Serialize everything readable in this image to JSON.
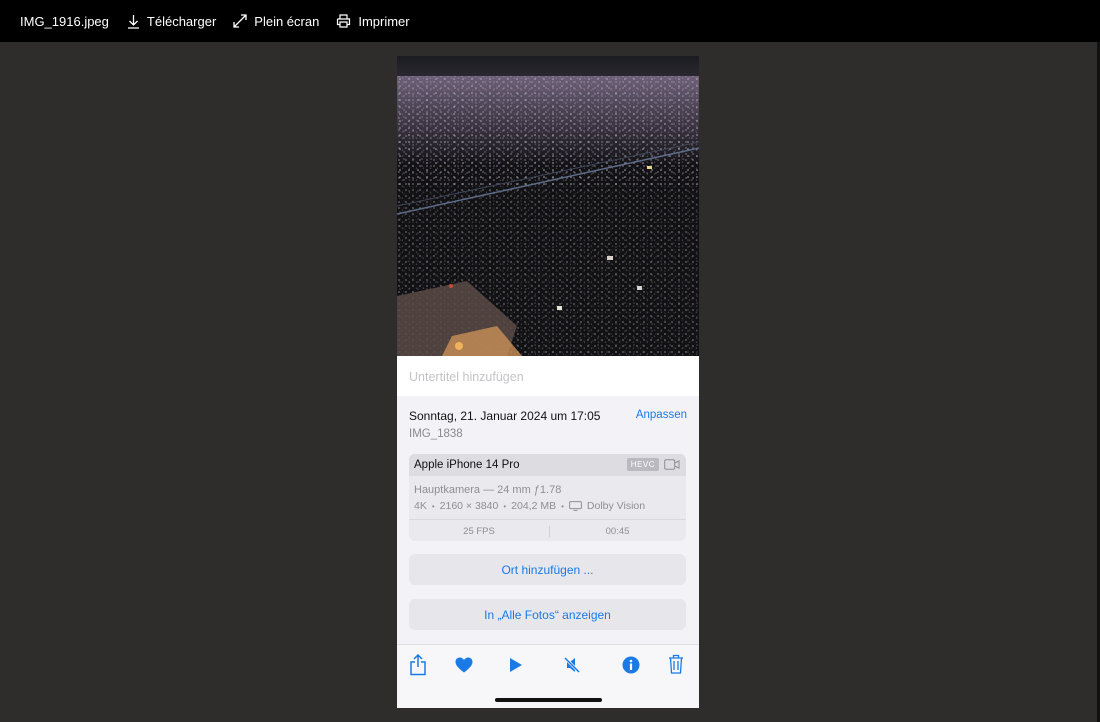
{
  "viewer": {
    "filename": "IMG_1916.jpeg",
    "actions": [
      {
        "label": "Télécharger",
        "icon": "download-icon"
      },
      {
        "label": "Plein écran",
        "icon": "fullscreen-icon"
      },
      {
        "label": "Imprimer",
        "icon": "print-icon"
      }
    ]
  },
  "photo_info": {
    "caption_placeholder": "Untertitel hinzufügen",
    "date": "Sonntag, 21. Januar 2024 um 17:05",
    "adjust_label": "Anpassen",
    "file_id": "IMG_1838",
    "device": "Apple iPhone 14 Pro",
    "format_badge": "HEVC",
    "lens": "Hauptkamera — 24 mm ƒ1.78",
    "resolution": "4K",
    "dimensions": "2160 × 3840",
    "size": "204,2 MB",
    "hdr": "Dolby Vision",
    "fps": "25 FPS",
    "duration": "00:45",
    "add_location": "Ort hinzufügen ...",
    "show_in_all": "In „Alle Fotos“ anzeigen"
  },
  "bottom_bar": [
    "share-icon",
    "favorite-heart-icon",
    "play-icon",
    "mute-icon",
    "info-icon",
    "trash-icon"
  ],
  "colors": {
    "accent": "#1a7ae6",
    "background": "#2e2d2b",
    "toolbar": "#000000"
  }
}
